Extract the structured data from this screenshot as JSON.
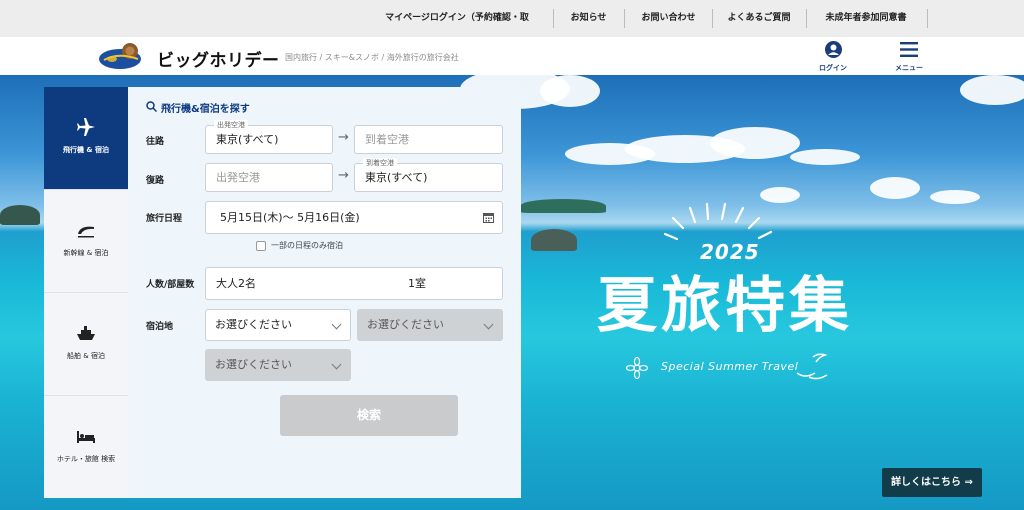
{
  "util_nav": {
    "items": [
      "マイページログイン（予約確認・取消）",
      "お知らせ",
      "お問い合わせ",
      "よくあるご質問",
      "未成年者参加同意書"
    ]
  },
  "header": {
    "logo_text": "ビッグホリデー",
    "tagline": "国内旅行 / スキー&スノボ / 海外旅行の旅行会社",
    "login_label": "ログイン",
    "menu_label": "メニュー",
    "icons": {
      "login": "user-icon",
      "menu": "hamburger-icon"
    }
  },
  "tabs": [
    {
      "label": "飛行機 & 宿泊",
      "icon": "airplane-icon",
      "active": true
    },
    {
      "label": "新幹線 & 宿泊",
      "icon": "train-icon",
      "active": false
    },
    {
      "label": "船舶 & 宿泊",
      "icon": "ship-icon",
      "active": false
    },
    {
      "label": "ホテル・旅館 検索",
      "icon": "bed-icon",
      "active": false
    }
  ],
  "form": {
    "title": "飛行機&宿泊を探す",
    "outbound": {
      "label": "往路",
      "from_caption": "出発空港",
      "from_value": "東京(すべて)",
      "to_placeholder": "到着空港"
    },
    "return": {
      "label": "復路",
      "from_placeholder": "出発空港",
      "to_caption": "到着空港",
      "to_value": "東京(すべて)"
    },
    "dates": {
      "label": "旅行日程",
      "value": "5月15日(木)～ 5月16日(金)",
      "partial_stay_label": "一部の日程のみ宿泊"
    },
    "guests": {
      "label": "人数/部屋数",
      "adults": "大人2名",
      "rooms": "1室"
    },
    "lodging": {
      "label": "宿泊地",
      "select1": "お選びください",
      "select2": "お選びください",
      "select3": "お選びください"
    },
    "search_label": "検索"
  },
  "hero": {
    "year": "2025",
    "title": "夏旅特集",
    "subtitle": "Special Summer Travel",
    "details_label": "詳しくはこちら ⇒"
  },
  "colors": {
    "brand_navy": "#0e3b80",
    "details_button": "#123c4a",
    "disabled_select": "#cfd2d5"
  }
}
